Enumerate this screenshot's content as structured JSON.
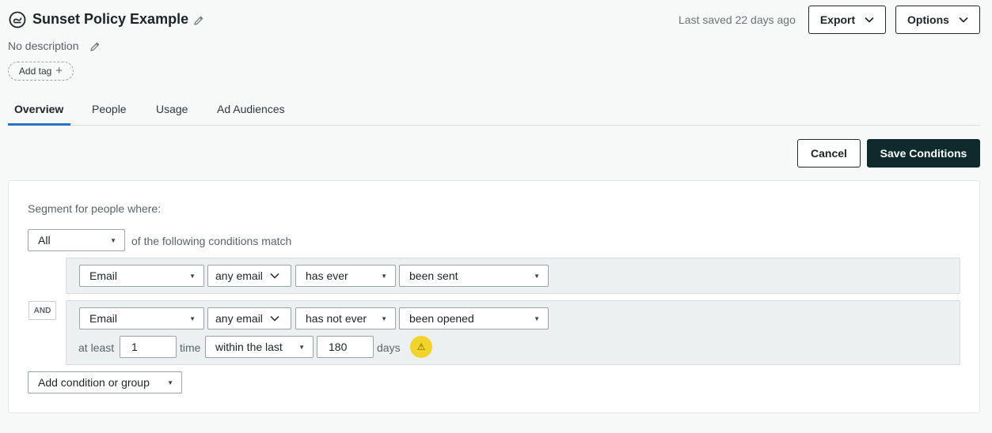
{
  "header": {
    "title": "Sunset Policy Example",
    "description": "No description",
    "add_tag_label": "Add tag",
    "last_saved": "Last saved 22 days ago",
    "export_label": "Export",
    "options_label": "Options"
  },
  "tabs": [
    {
      "label": "Overview",
      "active": true
    },
    {
      "label": "People",
      "active": false
    },
    {
      "label": "Usage",
      "active": false
    },
    {
      "label": "Ad Audiences",
      "active": false
    }
  ],
  "actions": {
    "cancel_label": "Cancel",
    "save_label": "Save Conditions"
  },
  "segment": {
    "label": "Segment for people where:",
    "match_select": "All",
    "match_text": "of the following conditions match",
    "and_label": "AND",
    "conditions": [
      {
        "type": "Email",
        "scope": "any email",
        "frequency": "has ever",
        "action": "been sent"
      },
      {
        "type": "Email",
        "scope": "any email",
        "frequency": "has not ever",
        "action": "been opened",
        "at_least_label": "at least",
        "count": "1",
        "time_label": "time",
        "window": "within the last",
        "days_value": "180",
        "days_label": "days"
      }
    ],
    "add_condition_label": "Add condition or group"
  },
  "colors": {
    "accent_tab": "#2a72c4",
    "primary_button": "#0e2a2c",
    "warning": "#f2d32c"
  }
}
